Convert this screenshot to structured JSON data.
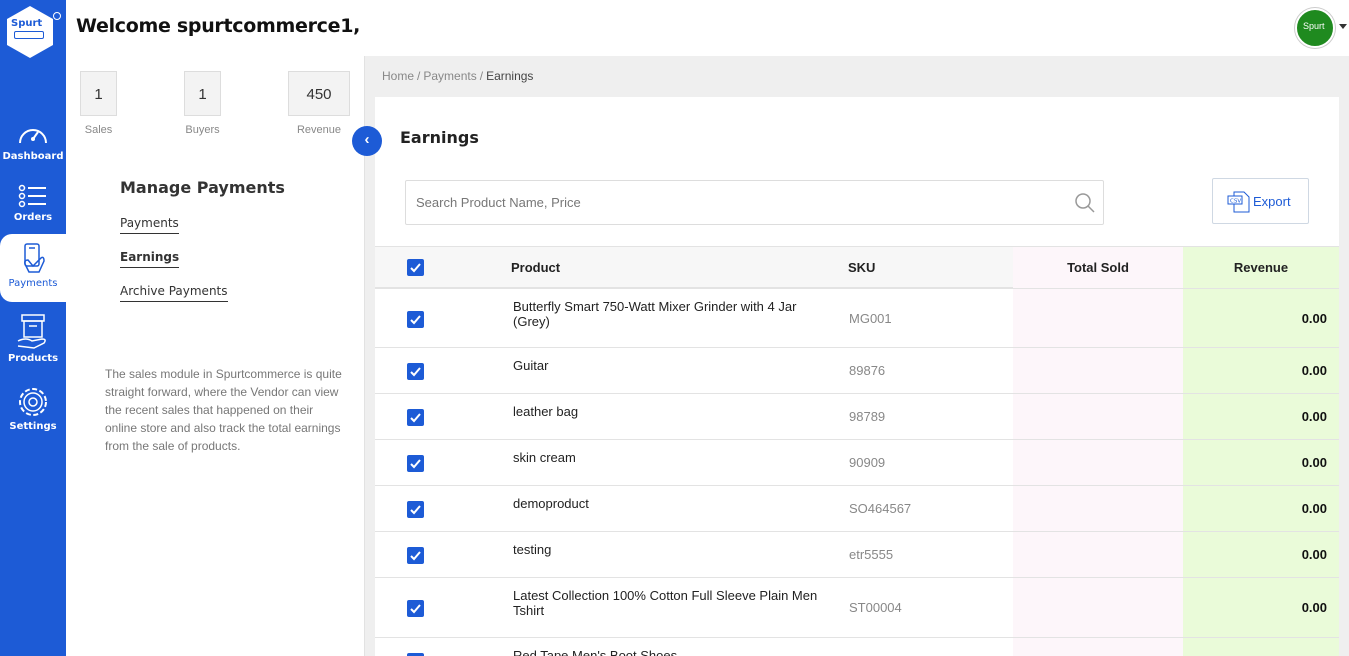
{
  "header": {
    "welcome": "Welcome spurtcommerce1,",
    "logo_text": "Spurt",
    "avatar_text": "Spurt"
  },
  "rail": {
    "items": [
      {
        "label": "Dashboard",
        "icon": "speedometer-icon"
      },
      {
        "label": "Orders",
        "icon": "list-icon"
      },
      {
        "label": "Payments",
        "icon": "payment-card-icon",
        "active": true
      },
      {
        "label": "Products",
        "icon": "box-icon"
      },
      {
        "label": "Settings",
        "icon": "gear-icon"
      }
    ]
  },
  "stats": [
    {
      "value": "1",
      "label": "Sales"
    },
    {
      "value": "1",
      "label": "Buyers"
    },
    {
      "value": "450",
      "label": "Revenue"
    }
  ],
  "manage": {
    "title": "Manage Payments",
    "links": [
      "Payments",
      "Earnings",
      "Archive Payments"
    ],
    "description": "The sales module in Spurtcommerce is quite straight forward, where the Vendor can view the recent sales that happened on their online store and also track the total earnings from the sale of products."
  },
  "breadcrumb": [
    "Home",
    "Payments",
    "Earnings"
  ],
  "card": {
    "title": "Earnings",
    "search_placeholder": "Search Product Name, Price",
    "export_label": "Export"
  },
  "table": {
    "headers": {
      "product": "Product",
      "sku": "SKU",
      "sold": "Total Sold",
      "revenue": "Revenue"
    },
    "rows": [
      {
        "product": "Butterfly Smart 750-Watt Mixer Grinder with 4 Jar (Grey)",
        "sku": "MG001",
        "sold": "",
        "revenue": "0.00"
      },
      {
        "product": "Guitar",
        "sku": "89876",
        "sold": "",
        "revenue": "0.00"
      },
      {
        "product": "leather bag",
        "sku": "98789",
        "sold": "",
        "revenue": "0.00"
      },
      {
        "product": "skin cream",
        "sku": "90909",
        "sold": "",
        "revenue": "0.00"
      },
      {
        "product": "demoproduct",
        "sku": "SO464567",
        "sold": "",
        "revenue": "0.00"
      },
      {
        "product": "testing",
        "sku": "etr5555",
        "sold": "",
        "revenue": "0.00"
      },
      {
        "product": "Latest Collection 100% Cotton Full Sleeve Plain Men Tshirt",
        "sku": "ST00004",
        "sold": "",
        "revenue": "0.00"
      },
      {
        "product": "Red Tape Men's Boot Shoes",
        "sku": "",
        "sold": "",
        "revenue": ""
      }
    ]
  },
  "colors": {
    "brand": "#1d5bd6",
    "sold_bg": "#fdf6fa",
    "revenue_bg": "#eafbd9"
  }
}
